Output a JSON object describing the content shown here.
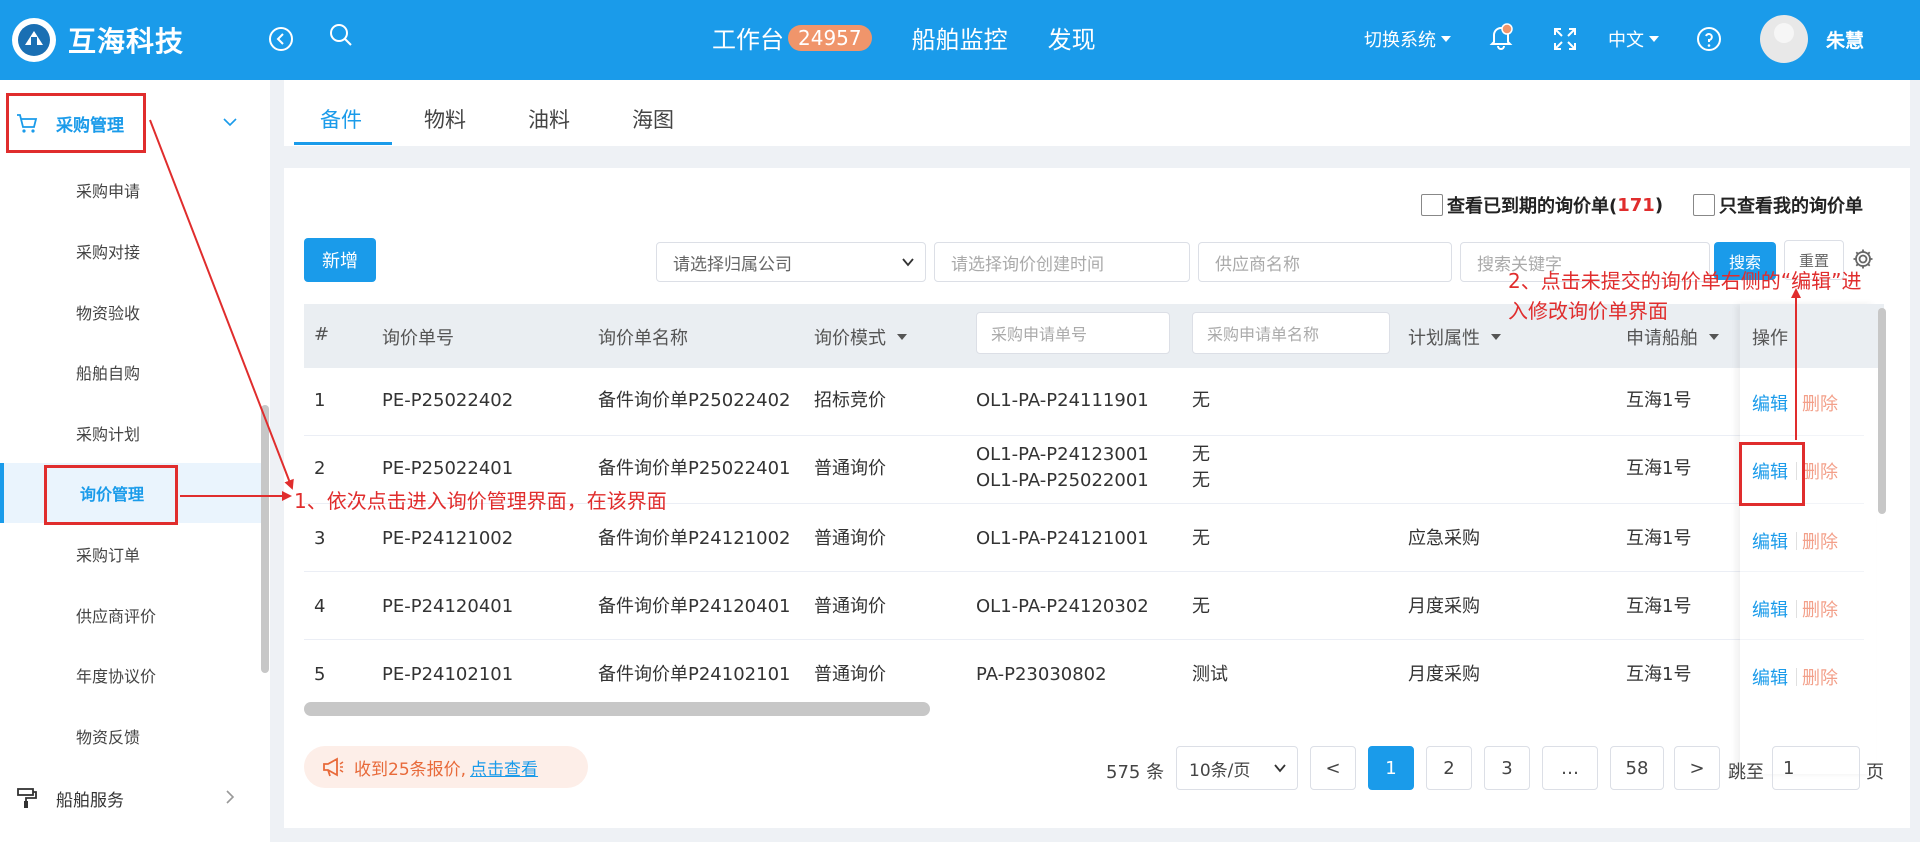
{
  "header": {
    "brand": "互海科技",
    "nav": [
      {
        "label": "工作台",
        "badge": "24957"
      },
      {
        "label": "船舶监控"
      },
      {
        "label": "发现"
      }
    ],
    "switch_system": "切换系统",
    "language": "中文",
    "username": "朱慧",
    "icons": [
      "back-circle-icon",
      "search-icon",
      "bell-icon",
      "fullscreen-icon",
      "help-icon"
    ],
    "colors": {
      "primary": "#1a9bea",
      "badge": "#f0956b"
    }
  },
  "sidebar": {
    "group_purchase": "采购管理",
    "items": [
      {
        "label": "采购申请"
      },
      {
        "label": "采购对接"
      },
      {
        "label": "物资验收"
      },
      {
        "label": "船舶自购"
      },
      {
        "label": "采购计划"
      },
      {
        "label": "询价管理",
        "active": true
      },
      {
        "label": "采购订单"
      },
      {
        "label": "供应商评价"
      },
      {
        "label": "年度协议价"
      },
      {
        "label": "物资反馈"
      }
    ],
    "group_ship": "船舶服务"
  },
  "tabs": [
    {
      "label": "备件",
      "active": true
    },
    {
      "label": "物料"
    },
    {
      "label": "油料"
    },
    {
      "label": "海图"
    }
  ],
  "filters": {
    "expired_label": "查看已到期的询价单(",
    "expired_count": "171",
    "expired_suffix": ")",
    "mine_label": "只查看我的询价单",
    "add_button": "新增",
    "company_placeholder": "请选择归属公司",
    "date_placeholder": "请选择询价创建时间",
    "supplier_placeholder": "供应商名称",
    "keyword_placeholder": "搜索关键字",
    "search_button": "搜索",
    "reset_button": "重置"
  },
  "table": {
    "headers": {
      "index": "#",
      "inquiry_no": "询价单号",
      "inquiry_name": "询价单名称",
      "mode": "询价模式",
      "req_no_placeholder": "采购申请单号",
      "req_name_placeholder": "采购申请单名称",
      "plan_attr": "计划属性",
      "ship": "申请船舶",
      "ops": "操作"
    },
    "rows": [
      {
        "idx": "1",
        "no": "PE-P25022402",
        "name": "备件询价单P25022402",
        "mode": "招标竞价",
        "req_no": [
          "OL1-PA-P24111901"
        ],
        "req_name": [
          "无"
        ],
        "plan": "",
        "ship": "互海1号",
        "edit": "编辑",
        "del": "删除"
      },
      {
        "idx": "2",
        "no": "PE-P25022401",
        "name": "备件询价单P25022401",
        "mode": "普通询价",
        "req_no": [
          "OL1-PA-P24123001",
          "OL1-PA-P25022001"
        ],
        "req_name": [
          "无",
          "无"
        ],
        "plan": "",
        "ship": "互海1号",
        "edit": "编辑",
        "del": "删除"
      },
      {
        "idx": "3",
        "no": "PE-P24121002",
        "name": "备件询价单P24121002",
        "mode": "普通询价",
        "req_no": [
          "OL1-PA-P24121001"
        ],
        "req_name": [
          "无"
        ],
        "plan": "应急采购",
        "ship": "互海1号",
        "edit": "编辑",
        "del": "删除"
      },
      {
        "idx": "4",
        "no": "PE-P24120401",
        "name": "备件询价单P24120401",
        "mode": "普通询价",
        "req_no": [
          "OL1-PA-P24120302"
        ],
        "req_name": [
          "无"
        ],
        "plan": "月度采购",
        "ship": "互海1号",
        "edit": "编辑",
        "del": "删除"
      },
      {
        "idx": "5",
        "no": "PE-P24102101",
        "name": "备件询价单P24102101",
        "mode": "普通询价",
        "req_no": [
          "PA-P23030802"
        ],
        "req_name": [
          "测试"
        ],
        "plan": "月度采购",
        "ship": "互海1号",
        "edit": "编辑",
        "del": "删除"
      }
    ]
  },
  "notice": {
    "text": "收到25条报价,",
    "link": "点击查看"
  },
  "pagination": {
    "total": "575 条",
    "page_size": "10条/页",
    "prev": "<",
    "pages": [
      "1",
      "2",
      "3",
      "…",
      "58"
    ],
    "current": "1",
    "next": ">",
    "jump_label": "跳至",
    "jump_value": "1",
    "unit": "页"
  },
  "annotations": {
    "step1": "1、依次点击进入询价管理界面，在该界面",
    "step2": "2、点击未提交的询价单右侧的“编辑”进入修改询价单界面",
    "color": "#e02d2d"
  }
}
